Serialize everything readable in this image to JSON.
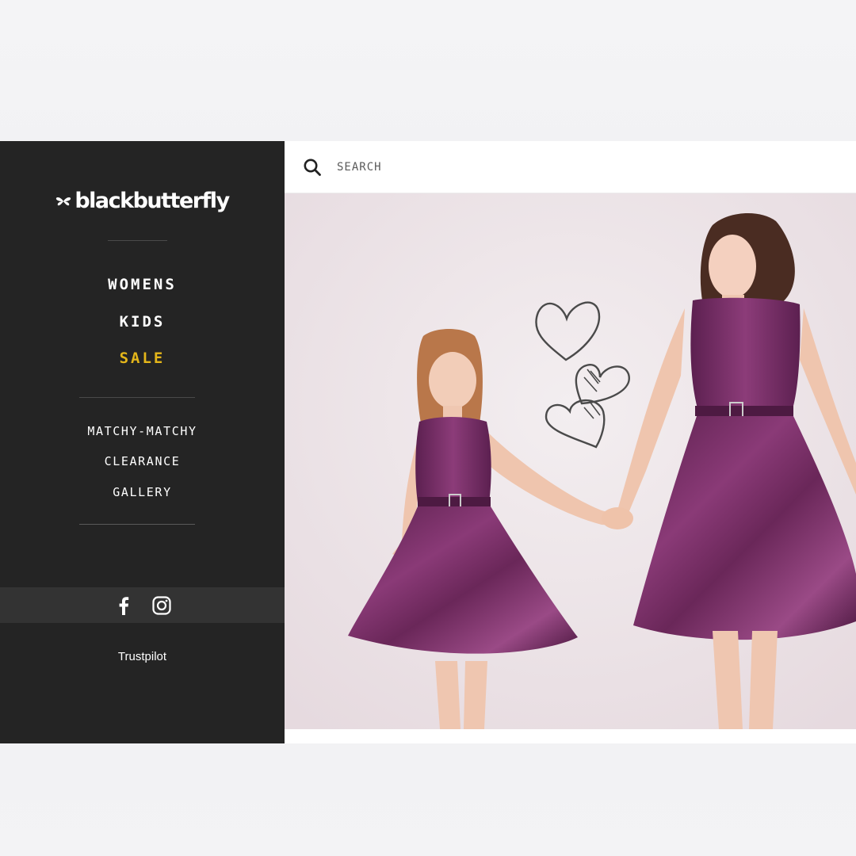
{
  "brand": {
    "name": "blackbutterfly"
  },
  "nav": {
    "primary": [
      {
        "label": "WOMENS"
      },
      {
        "label": "KIDS"
      },
      {
        "label": "SALE"
      }
    ],
    "secondary": [
      {
        "label": "MATCHY-MATCHY"
      },
      {
        "label": "CLEARANCE"
      },
      {
        "label": "GALLERY"
      }
    ]
  },
  "social": {
    "icons": [
      "facebook-icon",
      "instagram-icon"
    ]
  },
  "footer": {
    "trustpilot": "Trustpilot"
  },
  "search": {
    "placeholder": "SEARCH",
    "value": ""
  },
  "colors": {
    "sidebar_bg": "#242424",
    "accent_sale": "#e4b61a",
    "dress_purple": "#6e2a5c"
  }
}
